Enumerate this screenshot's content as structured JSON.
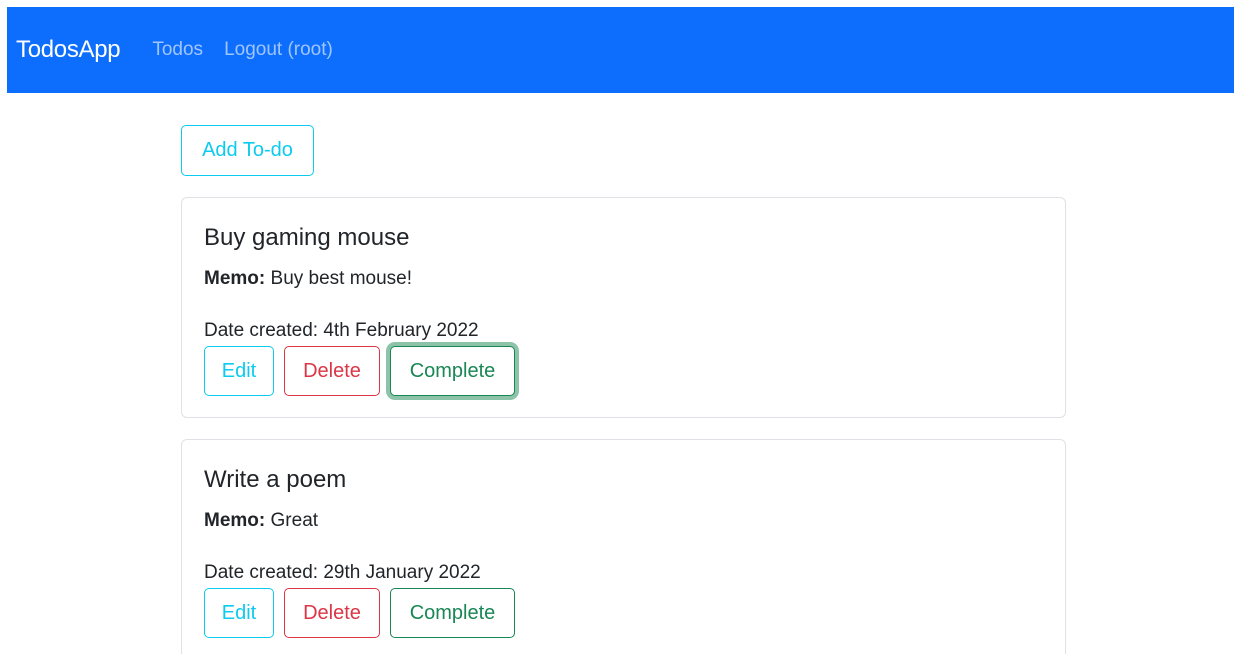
{
  "navbar": {
    "brand": "TodosApp",
    "links": [
      {
        "label": "Todos"
      },
      {
        "label": "Logout (root)"
      }
    ]
  },
  "add_button_label": "Add To-do",
  "memo_label": "Memo:",
  "todos": [
    {
      "title": "Buy gaming mouse",
      "memo": "Buy best mouse!",
      "date": "Date created: 4th February 2022",
      "completed": true,
      "edit_label": "Edit",
      "delete_label": "Delete",
      "complete_label": "Complete"
    },
    {
      "title": "Write a poem",
      "memo": "Great",
      "date": "Date created: 29th January 2022",
      "completed": false,
      "edit_label": "Edit",
      "delete_label": "Delete",
      "complete_label": "Complete"
    }
  ],
  "colors": {
    "navbar_bg": "#0d6efd",
    "info": "#0dcaf0",
    "danger": "#dc3545",
    "success": "#198754"
  }
}
